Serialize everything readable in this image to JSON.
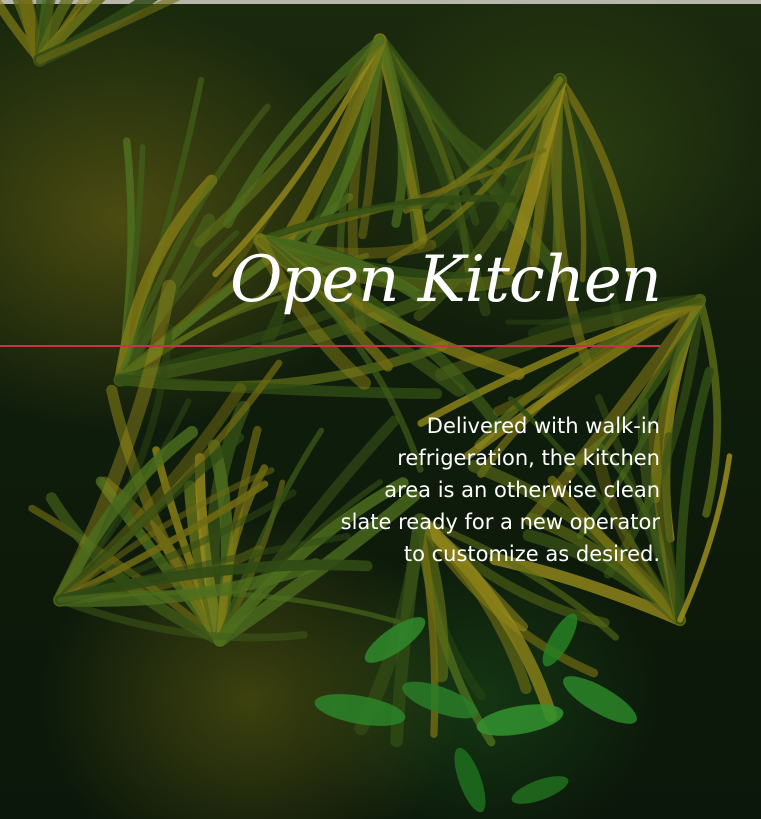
{
  "section": {
    "title": "Open Kitchen",
    "description_lines": [
      "Delivered with walk-in",
      "refrigeration, the kitchen",
      "area is an otherwise clean",
      "slate ready for a new operator",
      "to customize as desired."
    ]
  },
  "colors": {
    "accent_line": "#c8324a",
    "text": "#ffffff",
    "background": "#0f1d0b"
  },
  "background_image": "tropical-palm-foliage"
}
